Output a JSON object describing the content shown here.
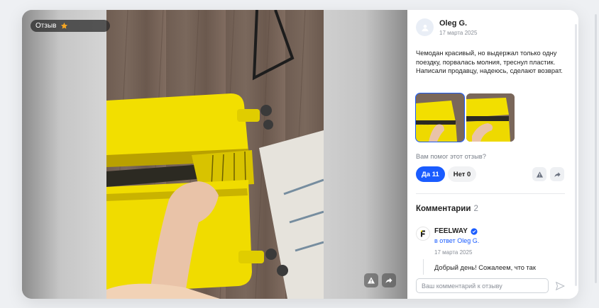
{
  "media": {
    "badge_label": "Отзыв",
    "badge_icon": "star-icon",
    "report_icon": "warning-icon",
    "share_icon": "share-icon",
    "accent_star_color": "#f5a623"
  },
  "review": {
    "author": "Oleg G.",
    "date": "17 марта 2025",
    "text": "Чемодан красивый, но выдержал только одну поездку, порвалась молния, треснул пластик. Написали продавцу, надеюсь, сделают возврат.",
    "helpful_question": "Вам помог этот отзыв?",
    "yes_label": "Да 11",
    "no_label": "Нет 0"
  },
  "comments": {
    "title": "Комментарии",
    "count": "2",
    "items": [
      {
        "author": "FEELWAY",
        "reply_to": "в ответ Oleg G.",
        "date": "17 марта 2025",
        "text": "Добрый день! Сожалеем, что так"
      }
    ]
  },
  "composer": {
    "placeholder": "Ваш комментарий к отзыву",
    "value": ""
  },
  "colors": {
    "primary": "#1a5cff",
    "suitcase": "#f2df00"
  }
}
